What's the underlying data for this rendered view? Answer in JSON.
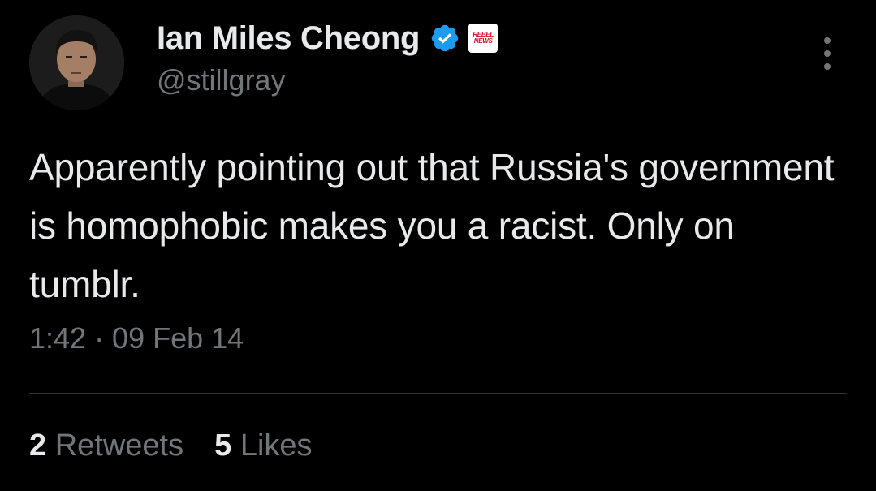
{
  "author": {
    "display_name": "Ian Miles Cheong",
    "handle": "@stillgray",
    "verified_color": "#1d9bf0",
    "affiliate_badge_text": "REBEL NEWS",
    "affiliate_badge_text_line1": "REBEL",
    "affiliate_badge_text_line2": "NEWS"
  },
  "tweet": {
    "text": "Apparently pointing out that Russia's government is homophobic makes you a racist. Only on tumblr.",
    "timestamp": "1:42 · 09 Feb 14"
  },
  "stats": {
    "retweets_count": "2",
    "retweets_label": "Retweets",
    "likes_count": "5",
    "likes_label": "Likes"
  },
  "icons": {
    "more": "more-options-icon",
    "verified": "verified-badge-icon"
  }
}
